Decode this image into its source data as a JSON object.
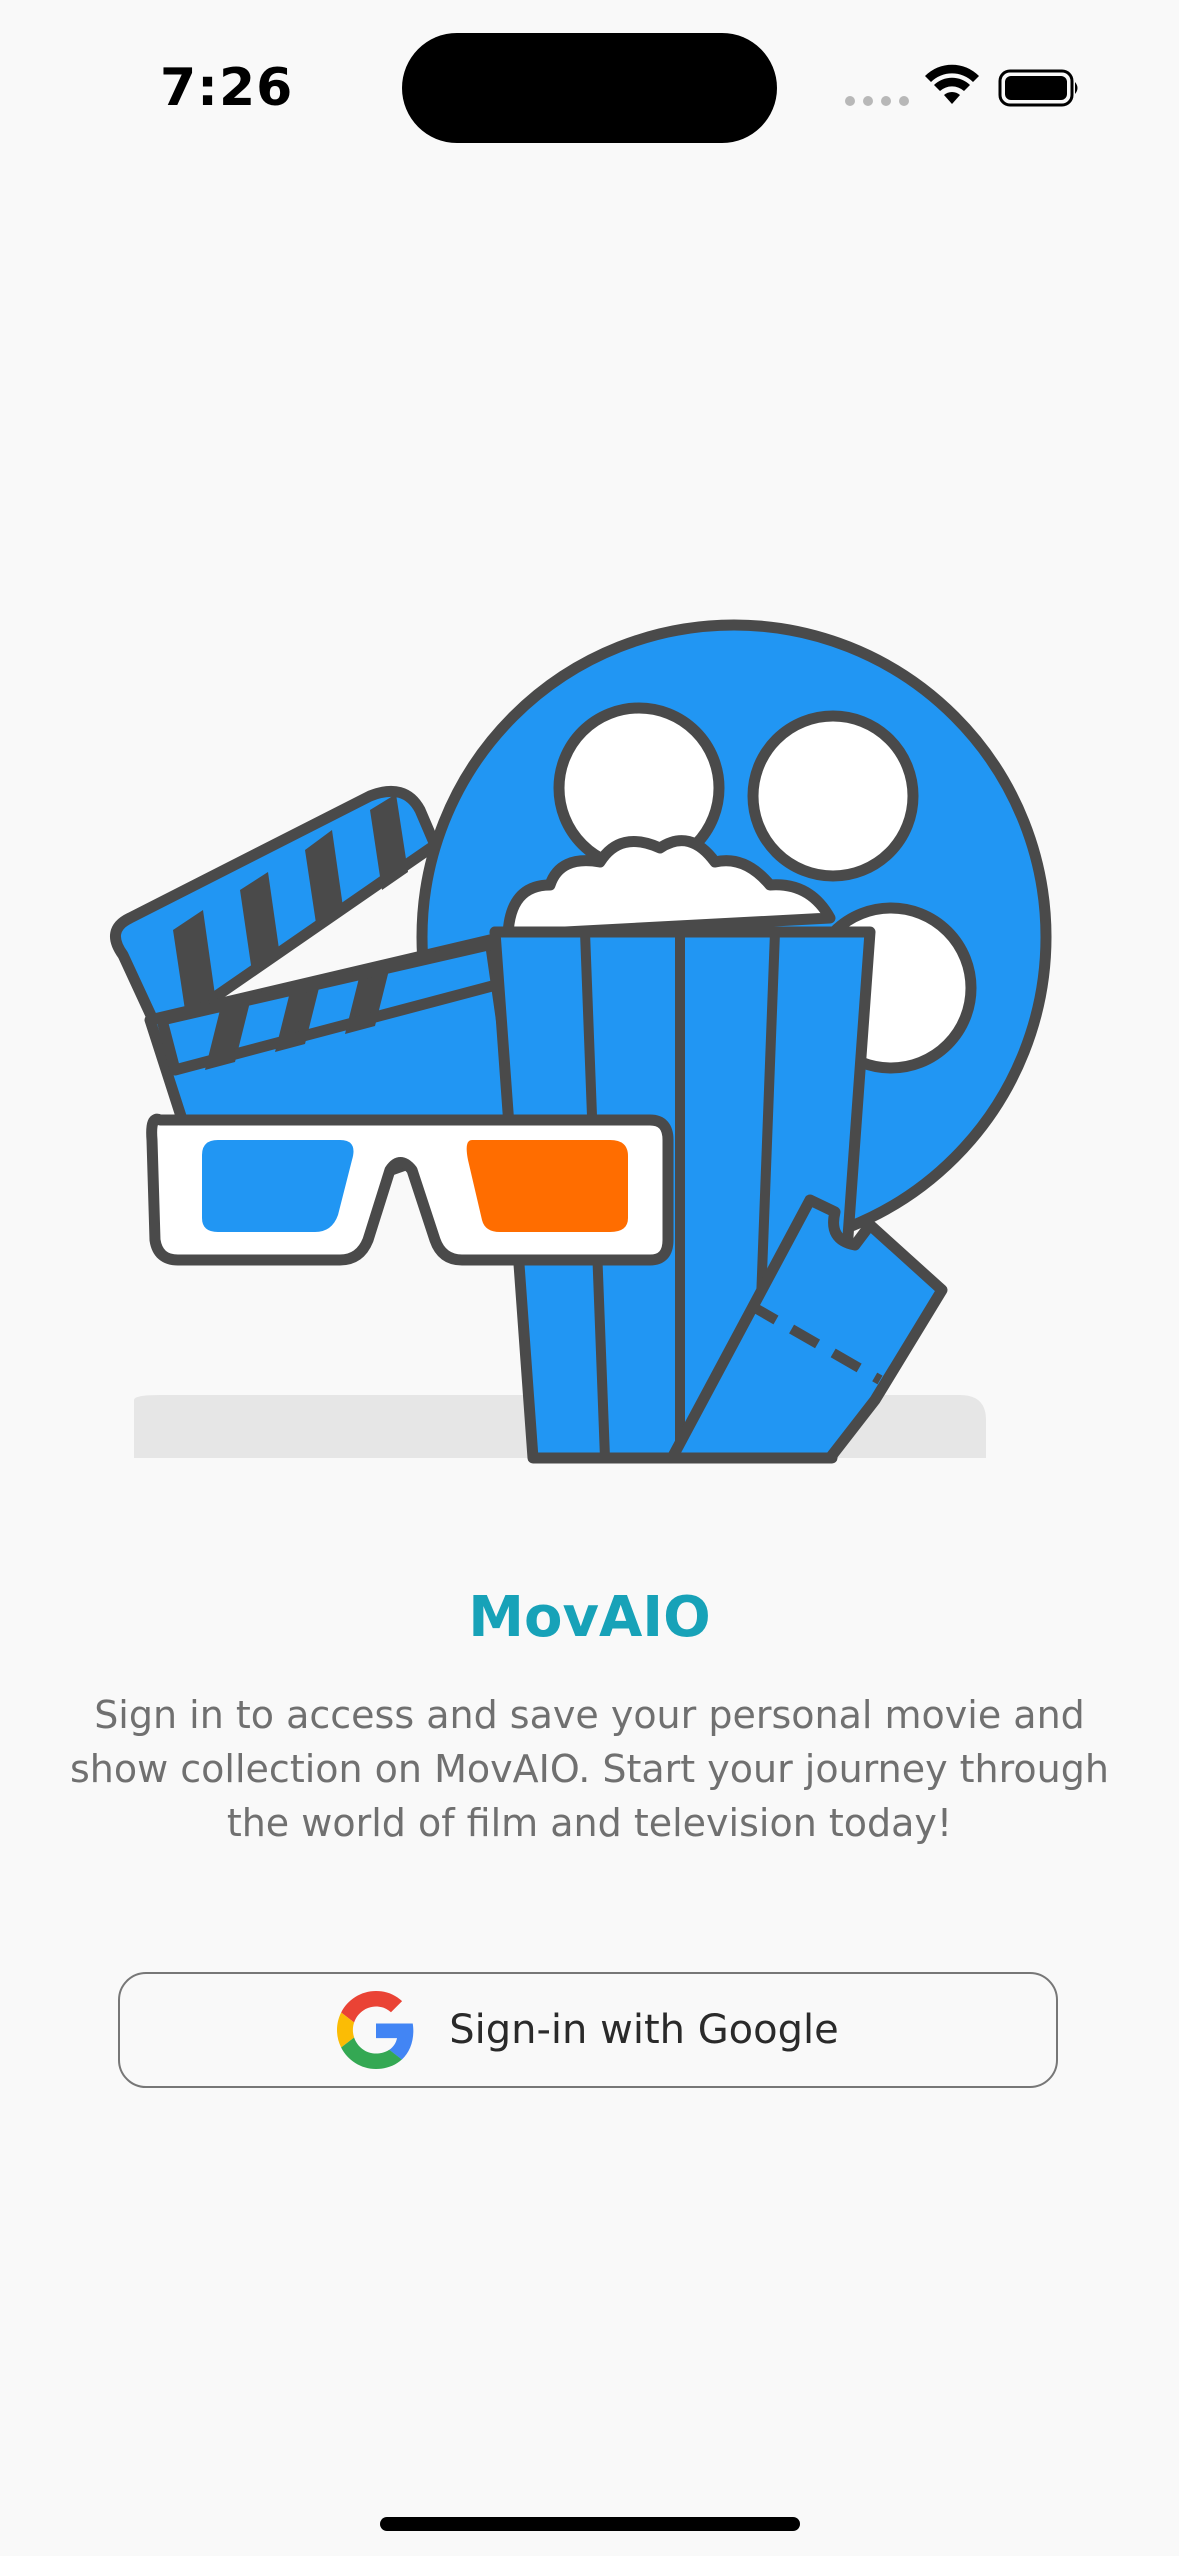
{
  "status_bar": {
    "time": "7:26"
  },
  "illustration": {
    "icon": "movie-clapper-popcorn-3d-glasses-illustration",
    "colors": {
      "blue": "#2196f3",
      "outline": "#4a4a4a",
      "orange": "#ff6d00",
      "white": "#ffffff",
      "shadow": "#e6e6e6"
    }
  },
  "app": {
    "title": "MovAIO",
    "description": "Sign in to access and save your personal movie and show collection on MovAIO. Start your journey through the world of film and television today!",
    "accent_color": "#17a2b8"
  },
  "auth": {
    "google_button_label": "Sign-in with Google",
    "google_icon": "google-g-icon"
  }
}
